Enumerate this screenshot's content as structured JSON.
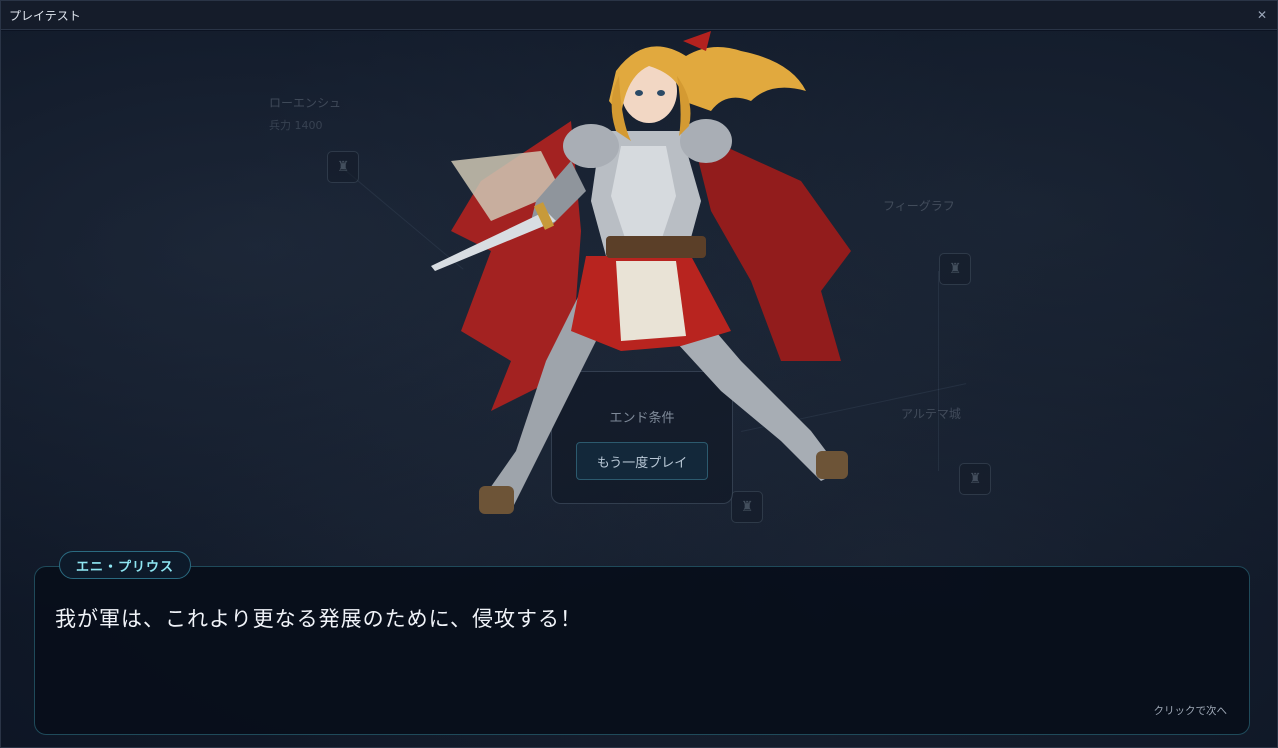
{
  "window": {
    "title": "プレイテスト",
    "close_icon": "close-icon"
  },
  "map": {
    "nodes": [
      {
        "name": "ローエンシュ",
        "sub": "兵力 1400"
      },
      {
        "name": "フィーグラフ"
      },
      {
        "name": "アルテマ城"
      }
    ]
  },
  "end_panel": {
    "label": "エンド条件",
    "replay_button": "もう一度プレイ"
  },
  "dialogue": {
    "speaker": "エニ・プリウス",
    "text": "我が軍は、これより更なる発展のために、侵攻する！",
    "hint": "クリックで次へ"
  },
  "colors": {
    "accent": "#8fe6f2",
    "border": "#1f4a5a",
    "background": "#0c1322"
  }
}
